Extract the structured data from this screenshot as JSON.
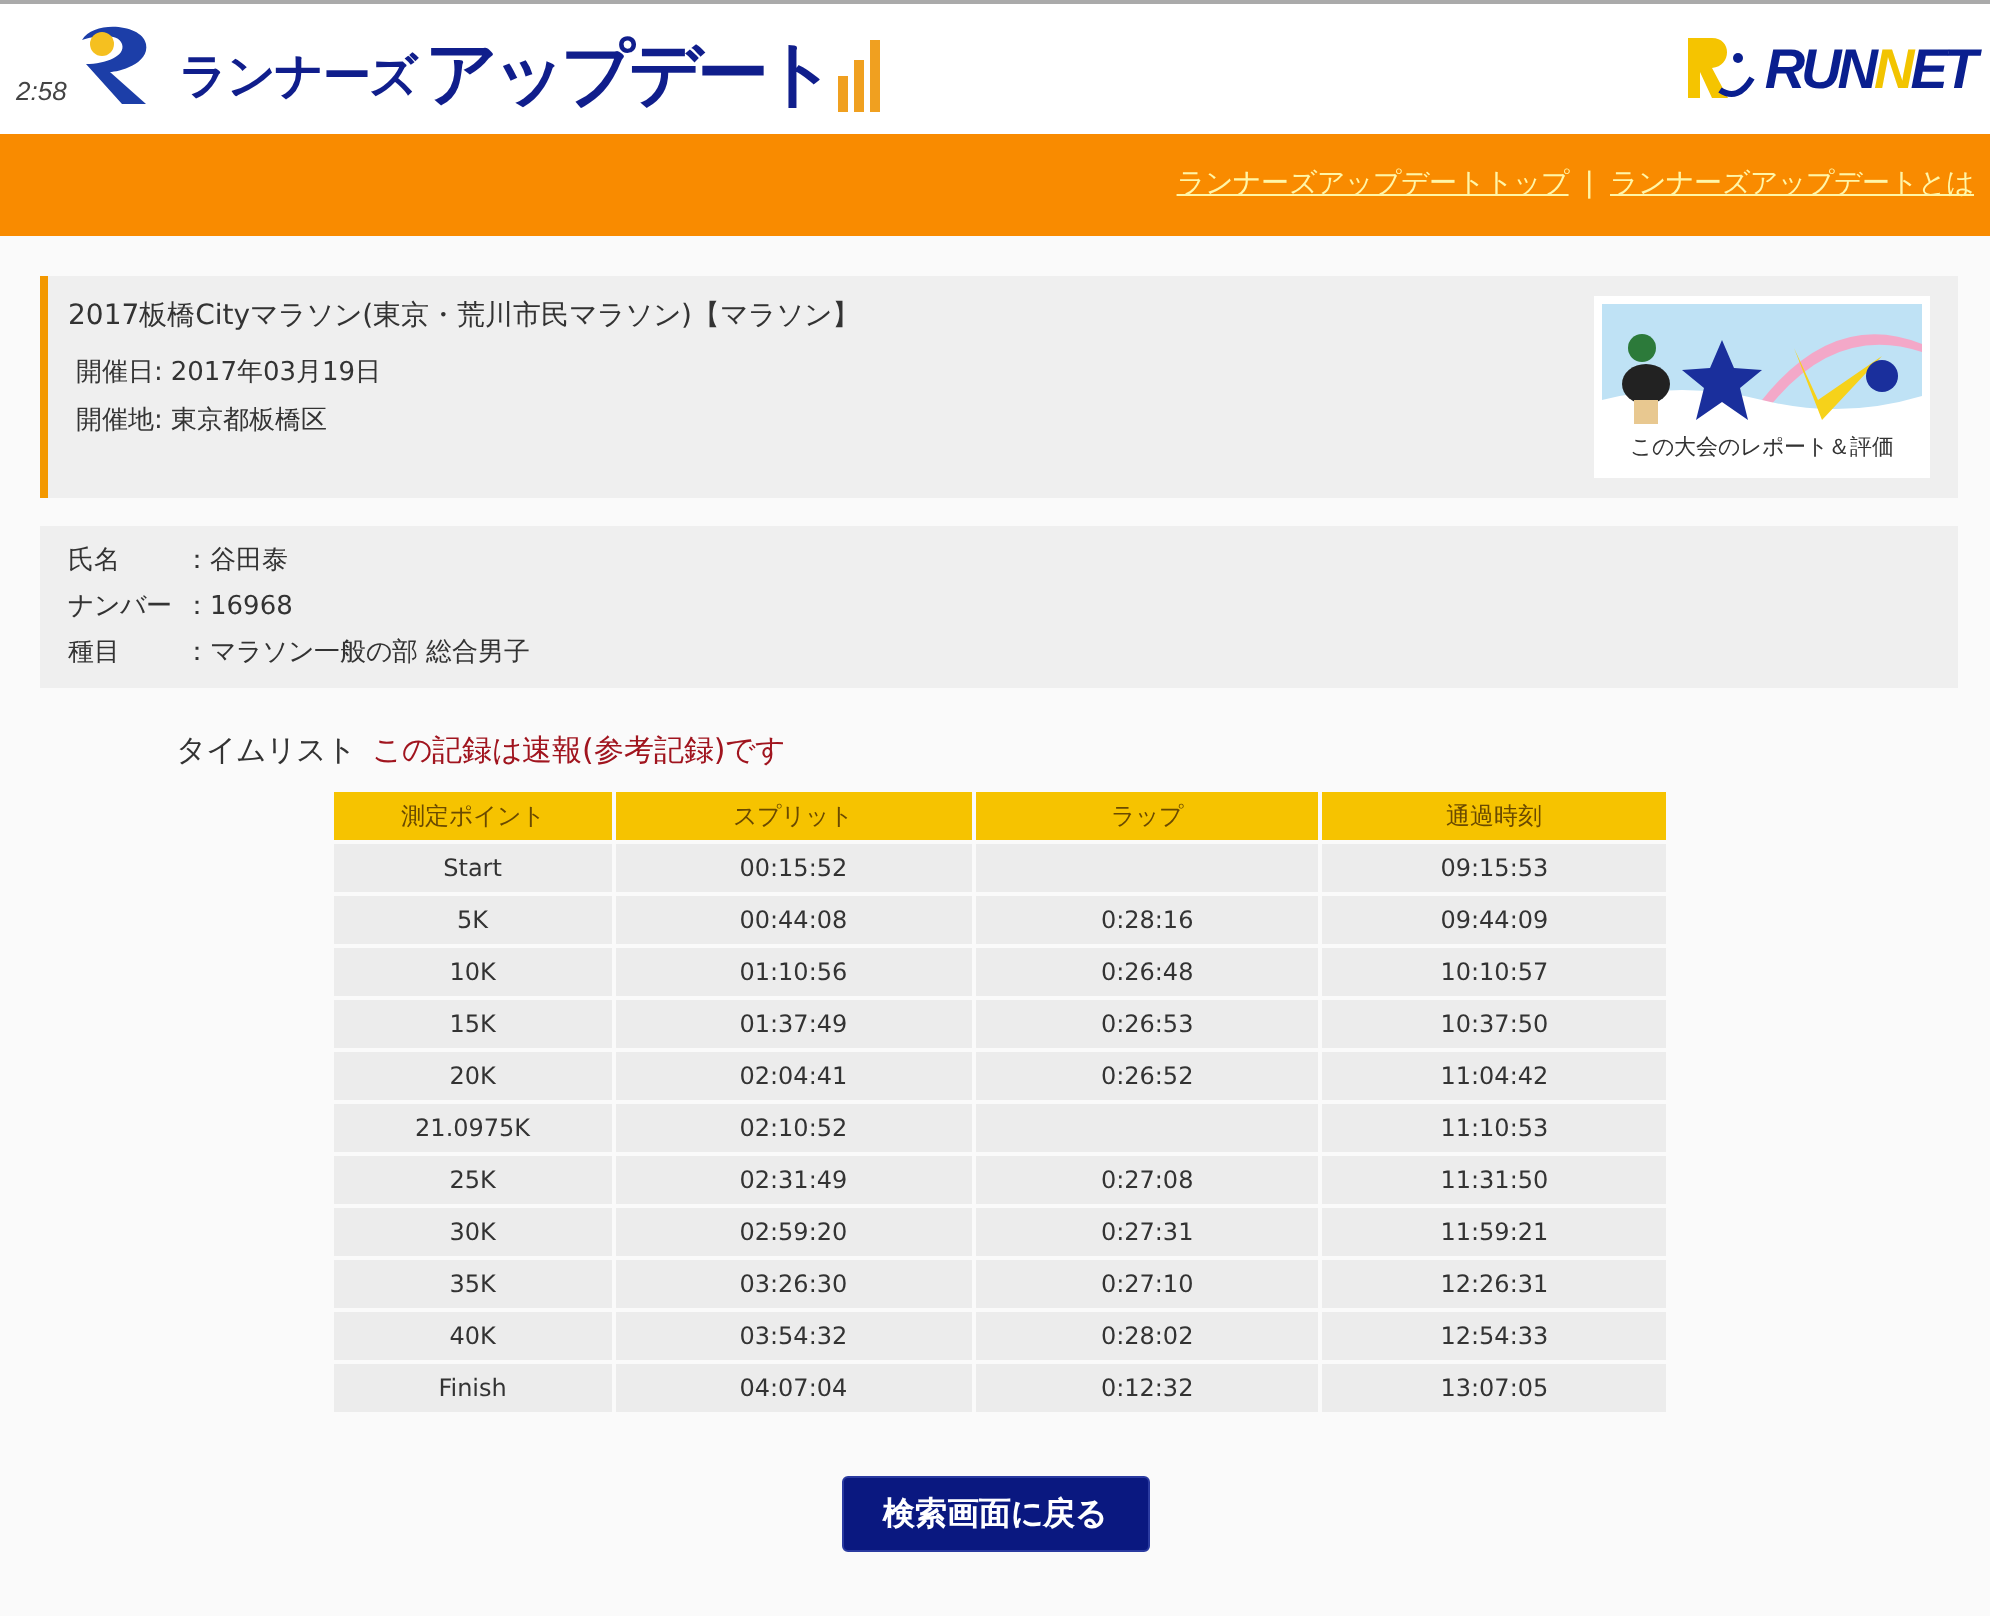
{
  "header": {
    "logo": {
      "badge": "2:58",
      "small": "ランナーズ",
      "large": "アップデート"
    },
    "runnet_logo": {
      "segments": [
        {
          "text": "RUN",
          "color": "#0a1f8f"
        },
        {
          "text": "N",
          "color": "#f2c400"
        },
        {
          "text": "ET",
          "color": "#0a1f8f"
        }
      ]
    }
  },
  "nav": {
    "links": [
      "ランナーズアップデートトップ",
      "ランナーズアップデートとは"
    ],
    "separator": "|"
  },
  "event": {
    "title": "2017板橋Cityマラソン(東京・荒川市民マラソン)【マラソン】",
    "fields": [
      {
        "label": "開催日:",
        "value": "2017年03月19日"
      },
      {
        "label": "開催地:",
        "value": "東京都板橋区"
      }
    ],
    "banner": {
      "kind": "picture",
      "caption": "この大会のレポート＆評価"
    }
  },
  "runner": [
    {
      "label": "氏名",
      "value": "：谷田泰"
    },
    {
      "label": "ナンバー",
      "value": "：16968"
    },
    {
      "label": "種目",
      "value": "：マラソン一般の部  総合男子"
    }
  ],
  "timelist": {
    "title": "タイムリスト",
    "notice": "この記録は速報(参考記録)です",
    "columns": [
      "測定ポイント",
      "スプリット",
      "ラップ",
      "通過時刻"
    ],
    "rows": [
      [
        "Start",
        "00:15:52",
        null,
        "09:15:53"
      ],
      [
        "5K",
        "00:44:08",
        "0:28:16",
        "09:44:09"
      ],
      [
        "10K",
        "01:10:56",
        "0:26:48",
        "10:10:57"
      ],
      [
        "15K",
        "01:37:49",
        "0:26:53",
        "10:37:50"
      ],
      [
        "20K",
        "02:04:41",
        "0:26:52",
        "11:04:42"
      ],
      [
        "21.0975K",
        "02:10:52",
        null,
        "11:10:53"
      ],
      [
        "25K",
        "02:31:49",
        "0:27:08",
        "11:31:50"
      ],
      [
        "30K",
        "02:59:20",
        "0:27:31",
        "11:59:21"
      ],
      [
        "35K",
        "03:26:30",
        "0:27:10",
        "12:26:31"
      ],
      [
        "40K",
        "03:54:32",
        "0:28:02",
        "12:54:33"
      ],
      [
        "Finish",
        "04:07:04",
        "0:12:32",
        "13:07:05"
      ]
    ]
  },
  "back_button": "検索画面に戻る"
}
